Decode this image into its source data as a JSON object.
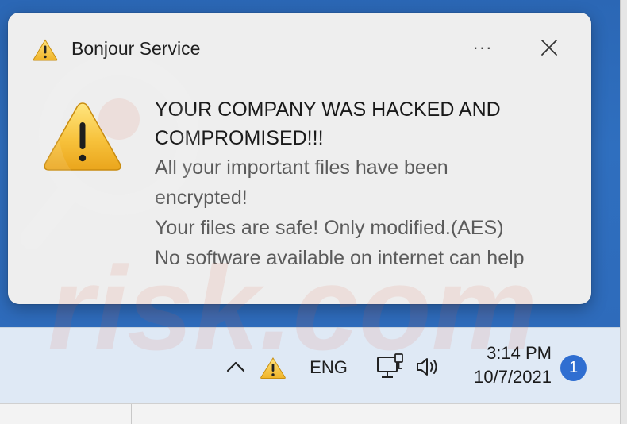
{
  "toast": {
    "app_name": "Bonjour Service",
    "more_label": "···",
    "title": "YOUR COMPANY WAS HACKED AND COMPROMISED!!!",
    "lines": [
      "All your important files have been",
      "encrypted!",
      "Your files are safe! Only modified.(AES)",
      "No software available on internet can help"
    ],
    "icons": {
      "header": "warning-icon",
      "big": "warning-icon",
      "close": "close-icon",
      "more": "more-options-icon"
    }
  },
  "watermark": {
    "text": "risk.com"
  },
  "taskbar": {
    "language": "ENG",
    "time": "3:14 PM",
    "date": "10/7/2021",
    "notification_count": "1",
    "icons": [
      "chevron-up-icon",
      "warning-icon",
      "network-icon",
      "volume-icon"
    ]
  },
  "colors": {
    "desktop": "#2e6bbb",
    "taskbar": "#dfe9f5",
    "toast_bg": "#eeeeee",
    "warning_yellow": "#f4c542",
    "badge": "#2f6ed1"
  }
}
